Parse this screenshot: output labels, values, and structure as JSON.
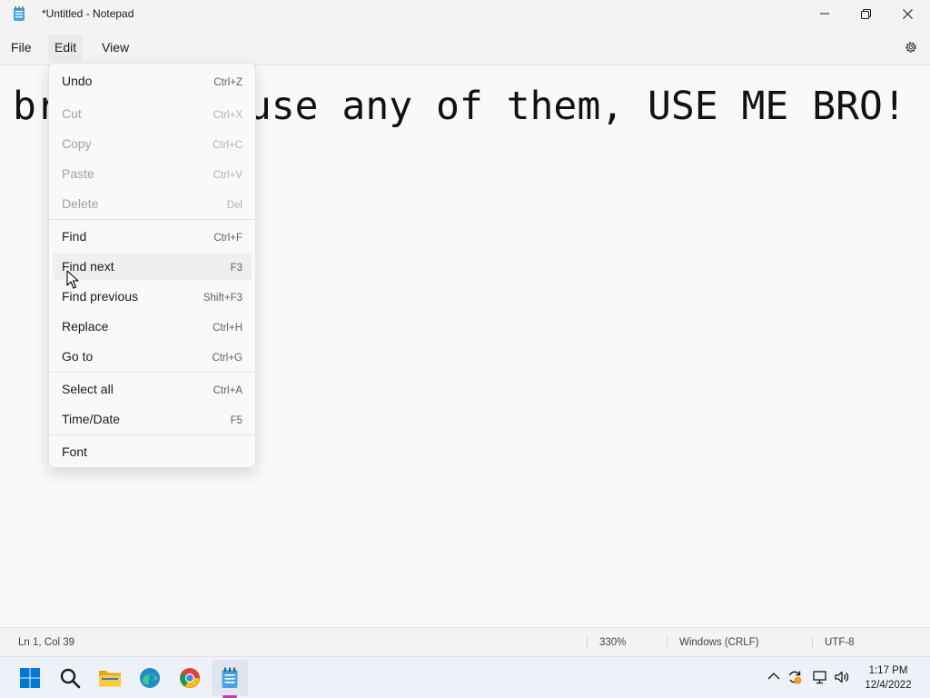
{
  "window": {
    "title": "*Untitled - Notepad"
  },
  "menubar": {
    "file": "File",
    "edit": "Edit",
    "view": "View"
  },
  "editor": {
    "text": "bro, dont use any of them, USE ME BRO!"
  },
  "edit_menu": {
    "items": [
      {
        "label": "Undo",
        "shortcut": "Ctrl+Z",
        "enabled": true
      },
      {
        "label": "Cut",
        "shortcut": "Ctrl+X",
        "enabled": false
      },
      {
        "label": "Copy",
        "shortcut": "Ctrl+C",
        "enabled": false
      },
      {
        "label": "Paste",
        "shortcut": "Ctrl+V",
        "enabled": false
      },
      {
        "label": "Delete",
        "shortcut": "Del",
        "enabled": false
      },
      {
        "label": "Find",
        "shortcut": "Ctrl+F",
        "enabled": true
      },
      {
        "label": "Find next",
        "shortcut": "F3",
        "enabled": true,
        "hovered": true
      },
      {
        "label": "Find previous",
        "shortcut": "Shift+F3",
        "enabled": true
      },
      {
        "label": "Replace",
        "shortcut": "Ctrl+H",
        "enabled": true
      },
      {
        "label": "Go to",
        "shortcut": "Ctrl+G",
        "enabled": true
      },
      {
        "label": "Select all",
        "shortcut": "Ctrl+A",
        "enabled": true
      },
      {
        "label": "Time/Date",
        "shortcut": "F5",
        "enabled": true
      },
      {
        "label": "Font",
        "shortcut": "",
        "enabled": true
      }
    ]
  },
  "statusbar": {
    "position": "Ln 1, Col 39",
    "zoom": "330%",
    "line_ending": "Windows (CRLF)",
    "encoding": "UTF-8"
  },
  "taskbar": {
    "apps": [
      "start-icon",
      "search-icon",
      "file-explorer-icon",
      "edge-icon",
      "chrome-icon",
      "notepad-icon"
    ],
    "active_app": "notepad-icon",
    "clock_time": "1:17 PM",
    "clock_date": "12/4/2022"
  },
  "colors": {
    "active_indicator": "#c239b3",
    "windows_blue": "#0078d4"
  }
}
